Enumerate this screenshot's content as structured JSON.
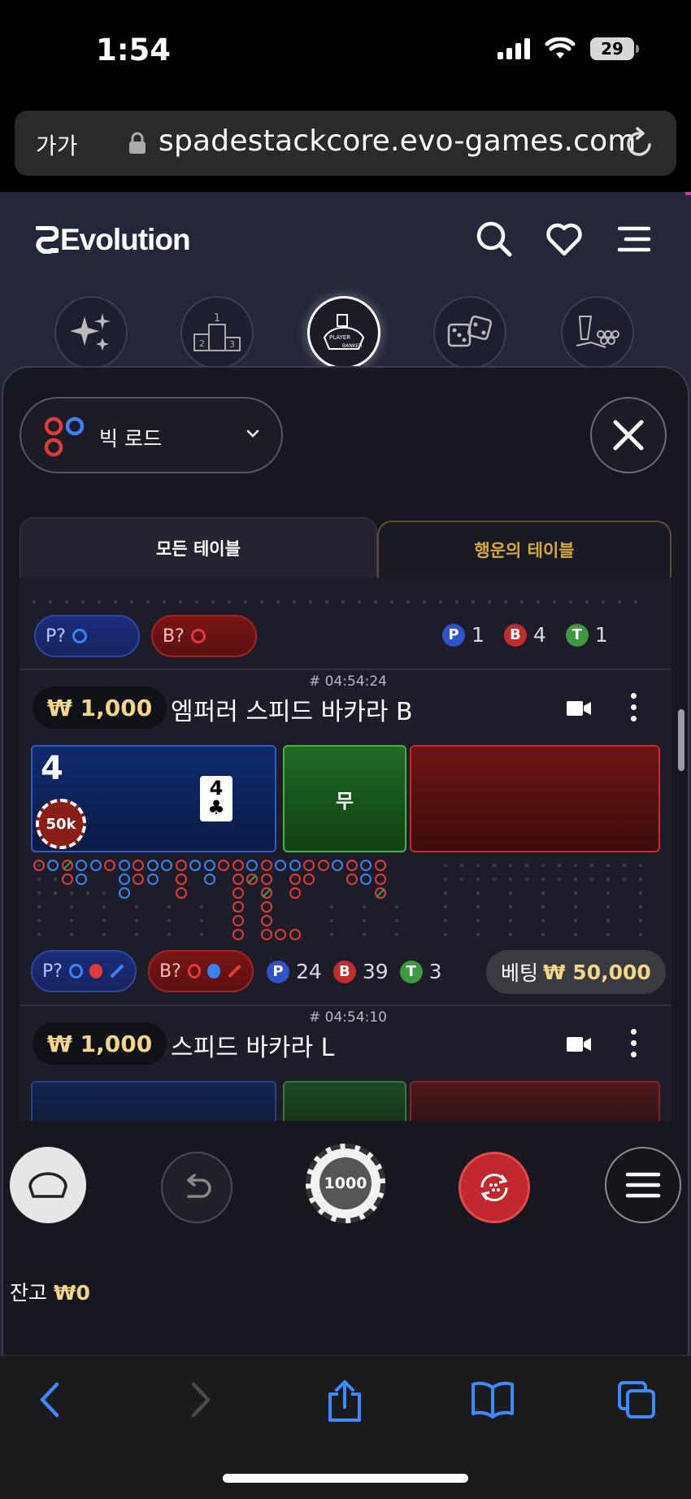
{
  "status_bar": {
    "time": "1:54",
    "battery": "29"
  },
  "browser": {
    "text_size_label": "가가",
    "url": "spadestackcore.evo-games.com"
  },
  "header": {
    "brand": "Evolution"
  },
  "categories": [
    {
      "name": "featured",
      "icon": "sparkles-icon"
    },
    {
      "name": "top-games",
      "icon": "podium-icon"
    },
    {
      "name": "baccarat",
      "icon": "baccarat-icon",
      "active": true
    },
    {
      "name": "dice",
      "icon": "dice-icon"
    },
    {
      "name": "game-shows",
      "icon": "chip-stack-icon"
    }
  ],
  "road_selector": {
    "label": "빅 로드"
  },
  "tabs": {
    "all": "모든 테이블",
    "lucky": "행운의 테이블"
  },
  "partial_row": {
    "p_pill": "P?",
    "b_pill": "B?",
    "p_label": "P",
    "p_count": "1",
    "b_label": "B",
    "b_count": "4",
    "t_label": "T",
    "t_count": "1"
  },
  "tables": [
    {
      "id": "# 04:54:24",
      "stake": "₩ 1,000",
      "name": "엠퍼러 스피드 바카라 B",
      "player_score": "4",
      "card_rank": "4",
      "card_suit": "♣",
      "chip": "50k",
      "tie_label": "무",
      "p_pill": "P?",
      "b_pill": "B?",
      "p_label": "P",
      "p_count": "24",
      "b_label": "B",
      "b_count": "39",
      "t_label": "T",
      "t_count": "3",
      "betting_label": "베팅",
      "betting_amount": "₩ 50,000"
    },
    {
      "id": "# 04:54:10",
      "stake": "₩ 1,000",
      "name": "스피드 바카라 L"
    }
  ],
  "controls": {
    "chip_value": "1000"
  },
  "balance": {
    "label": "잔고",
    "amount": "₩0"
  },
  "colors": {
    "accent_gold": "#f2d68a",
    "player_blue": "#2f54c9",
    "banker_red": "#c32c2c",
    "tie_green": "#3d9a43"
  }
}
